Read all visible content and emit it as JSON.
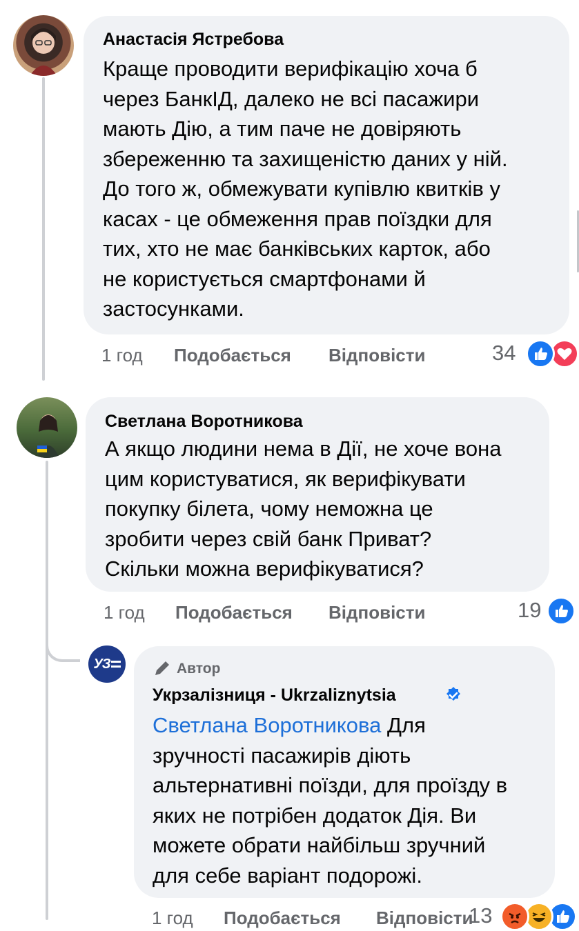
{
  "comments": [
    {
      "author": "Анастасія Ястребова",
      "lines": [
        "Краще проводити верифікацію хоча б",
        "через БанкІД, далеко не всі пасажири",
        "мають Дію, а тим паче не довіряють",
        "збереженню та захищеністю даних у ній.",
        "До того ж, обмежувати купівлю квитків у",
        "касах - це обмеження прав поїздки для",
        "тих, хто не має банківських карток, або",
        "не користується смартфонами й",
        "застосунками."
      ],
      "time": "1 год",
      "like_label": "Подобається",
      "reply_label": "Відповісти",
      "reaction_count": "34"
    },
    {
      "author": "Светлана Воротникова",
      "lines": [
        "А якщо людини нема в Дії, не хоче вона",
        "цим користуватися, як верифікувати",
        "покупку білета, чому неможна це",
        "зробити через свій банк Приват?",
        "Скільки можна верифікуватися?"
      ],
      "time": "1 год",
      "like_label": "Подобається",
      "reply_label": "Відповісти",
      "reaction_count": "19"
    }
  ],
  "reply": {
    "badge": "Автор",
    "author": "Укрзалізниця - Ukrzaliznytsia",
    "avatar_text": "УЗ",
    "mention": "Светлана Воротникова",
    "first_line_rest": " Для",
    "lines": [
      "зручності пасажирів діють",
      "альтернативні поїзди, для проїзду в",
      "яких не потрібен додаток Дія. Ви",
      "можете обрати найбільш зручний",
      "для себе варіант подорожі."
    ],
    "time": "1 год",
    "like_label": "Подобається",
    "reply_label": "Відповісти",
    "reaction_count": "13"
  },
  "icons": {
    "like": "like-icon",
    "love": "love-icon",
    "angry": "angry-icon",
    "haha": "haha-icon",
    "verified": "verified-badge-icon",
    "pencil": "pencil-icon"
  },
  "colors": {
    "bubble": "#f0f2f5",
    "meta": "#65676b",
    "like_blue": "#1877f2",
    "love_red": "#f33e58",
    "mention": "#1d6fd8",
    "uz_brand": "#1e3a8a"
  }
}
